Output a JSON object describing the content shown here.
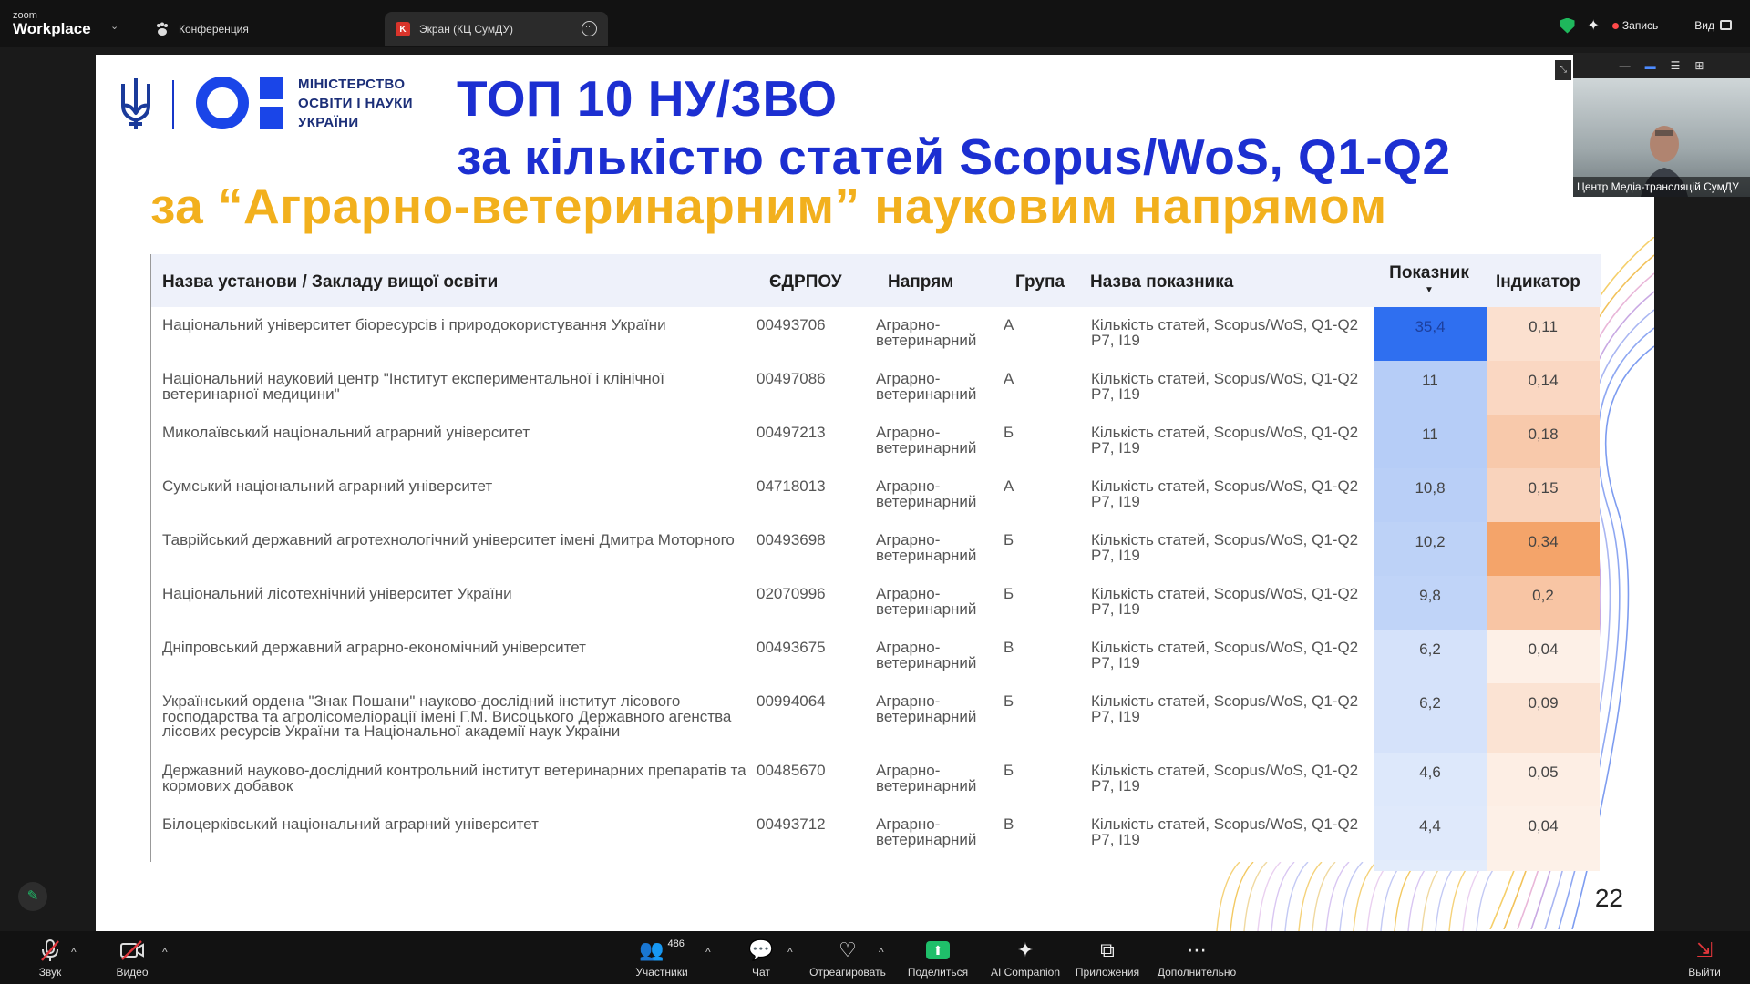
{
  "app": {
    "brand_small": "zoom",
    "brand_big": "Workplace"
  },
  "tabs": [
    {
      "label": "Конференция",
      "icon": "paw-icon"
    },
    {
      "label": "Экран (КЦ СумДУ)",
      "icon": "k-icon",
      "icon_text": "K"
    }
  ],
  "top_right": {
    "record_label": "Запись",
    "view_label": "Вид"
  },
  "slide": {
    "logo_line1": "МІНІСТЕРСТВО",
    "logo_line2": "ОСВІТИ І НАУКИ",
    "logo_line3": "УКРАЇНИ",
    "title_line1": "ТОП 10 НУ/ЗВО",
    "title_line2": "за кількістю статей Scopus/WoS, Q1-Q2",
    "title_line3": "за “Аграрно-ветеринарним” науковим напрямом",
    "page_number": "22",
    "table": {
      "headers": {
        "name": "Назва установи / Закладу вищої освіти",
        "code": "ЄДРПОУ",
        "direction": "Напрям",
        "group": "Група",
        "indicator_name": "Назва показника",
        "value": "Показник",
        "indicator": "Індикатор"
      },
      "sort_arrow": "▼",
      "rows": [
        {
          "name": "Національний університет біоресурсів і природокористування України",
          "code": "00493706",
          "direction": "Аграрно-ветеринарний",
          "group": "А",
          "indicator_name": "Кількість статей, Scopus/WoS, Q1-Q2 P7, I19",
          "value": "35,4",
          "indicator": "0,11",
          "value_color": "#2f6ff0",
          "indicator_color": "#fbe0cf"
        },
        {
          "name": "Національний науковий центр \"Інститут експериментальної і клінічної ветеринарної медицини\"",
          "code": "00497086",
          "direction": "Аграрно-ветеринарний",
          "group": "А",
          "indicator_name": "Кількість статей, Scopus/WoS, Q1-Q2 P7, I19",
          "value": "11",
          "indicator": "0,14",
          "value_color": "#b6cdf7",
          "indicator_color": "#fad7c2"
        },
        {
          "name": "Миколаївський національний аграрний університет",
          "code": "00497213",
          "direction": "Аграрно-ветеринарний",
          "group": "Б",
          "indicator_name": "Кількість статей, Scopus/WoS, Q1-Q2 P7, I19",
          "value": "11",
          "indicator": "0,18",
          "value_color": "#b6cdf7",
          "indicator_color": "#f8c9ab"
        },
        {
          "name": "Сумський національний аграрний університет",
          "code": "04718013",
          "direction": "Аграрно-ветеринарний",
          "group": "А",
          "indicator_name": "Кількість статей, Scopus/WoS, Q1-Q2 P7, I19",
          "value": "10,8",
          "indicator": "0,15",
          "value_color": "#b9cff7",
          "indicator_color": "#f9d3bc"
        },
        {
          "name": "Таврійський державний агротехнологічний університет імені Дмитра Моторного",
          "code": "00493698",
          "direction": "Аграрно-ветеринарний",
          "group": "Б",
          "indicator_name": "Кількість статей, Scopus/WoS, Q1-Q2 P7, I19",
          "value": "10,2",
          "indicator": "0,34",
          "value_color": "#bdd2f7",
          "indicator_color": "#f4a46a"
        },
        {
          "name": "Національний лісотехнічний університет України",
          "code": "02070996",
          "direction": "Аграрно-ветеринарний",
          "group": "Б",
          "indicator_name": "Кількість статей, Scopus/WoS, Q1-Q2 P7, I19",
          "value": "9,8",
          "indicator": "0,2",
          "value_color": "#c0d4f8",
          "indicator_color": "#f8c5a4"
        },
        {
          "name": "Дніпровський державний аграрно-економічний університет",
          "code": "00493675",
          "direction": "Аграрно-ветеринарний",
          "group": "В",
          "indicator_name": "Кількість статей, Scopus/WoS, Q1-Q2 P7, I19",
          "value": "6,2",
          "indicator": "0,04",
          "value_color": "#d5e2fa",
          "indicator_color": "#fdf0e7"
        },
        {
          "name": "Український ордена \"Знак Пошани\" науково-дослідний інститут лісового господарства та агролісомеліорації імені Г.М. Висоцького Державного агенства лісових ресурсів України та Національної академії наук України",
          "code": "00994064",
          "direction": "Аграрно-ветеринарний",
          "group": "Б",
          "indicator_name": "Кількість статей, Scopus/WoS, Q1-Q2 P7, I19",
          "value": "6,2",
          "indicator": "0,09",
          "value_color": "#d5e2fa",
          "indicator_color": "#fbe3d3"
        },
        {
          "name": "Державний науково-дослідний контрольний інститут ветеринарних препаратів та кормових добавок",
          "code": "00485670",
          "direction": "Аграрно-ветеринарний",
          "group": "Б",
          "indicator_name": "Кількість статей, Scopus/WoS, Q1-Q2 P7, I19",
          "value": "4,6",
          "indicator": "0,05",
          "value_color": "#dde8fb",
          "indicator_color": "#fdeee4"
        },
        {
          "name": "Білоцерківський національний аграрний університет",
          "code": "00493712",
          "direction": "Аграрно-ветеринарний",
          "group": "В",
          "indicator_name": "Кількість статей, Scopus/WoS, Q1-Q2 P7, I19",
          "value": "4,4",
          "indicator": "0,04",
          "value_color": "#dfe9fb",
          "indicator_color": "#fdf0e7"
        }
      ]
    }
  },
  "video": {
    "name": "Центр Медіа-трансляцій СумДУ"
  },
  "bottom": {
    "audio": "Звук",
    "video": "Видео",
    "participants": "Участники",
    "participants_count": "486",
    "chat": "Чат",
    "react": "Отреагировать",
    "share": "Поделиться",
    "ai": "AI Companion",
    "apps": "Приложения",
    "more": "Дополнительно",
    "leave": "Выйти"
  }
}
